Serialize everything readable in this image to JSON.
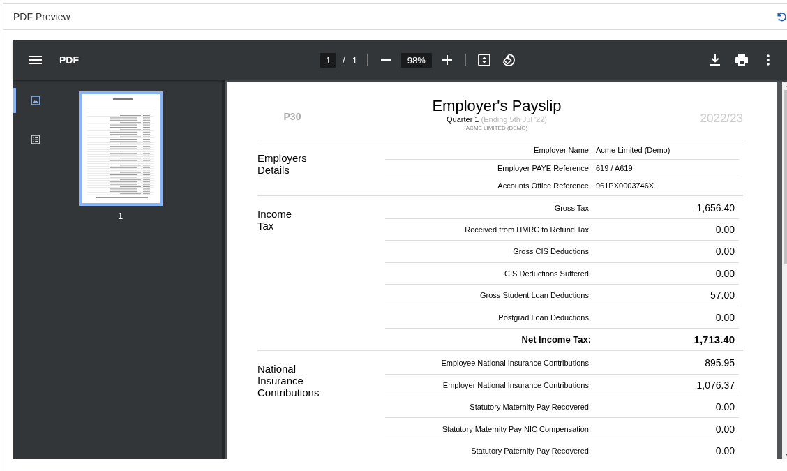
{
  "panel": {
    "title": "PDF Preview"
  },
  "toolbar": {
    "title": "PDF",
    "page": "1",
    "page_separator": "/",
    "page_count": "1",
    "zoom": "98%"
  },
  "sidebar": {
    "tabs": [
      {
        "kind": "thumbnails",
        "selected": true
      },
      {
        "kind": "outline",
        "selected": false
      }
    ],
    "thumbnails": [
      {
        "label": "1",
        "selected": true
      }
    ]
  },
  "document": {
    "form": "P30",
    "title": "Employer's Payslip",
    "quarter": "Quarter 1",
    "quarter_note": "(Ending 5th Jul '22)",
    "company": "ACME LIMITED (DEMO)",
    "year": "2022/23",
    "sections": [
      {
        "title": [
          "Employers",
          "Details"
        ],
        "rows": [
          {
            "kind": "detail",
            "label": "Employer Name:",
            "value": "Acme Limited (Demo)"
          },
          {
            "kind": "detail",
            "label": "Employer PAYE Reference:",
            "value": "619 / A619"
          },
          {
            "kind": "detail",
            "label": "Accounts Office Reference:",
            "value": "961PX0003746X"
          }
        ]
      },
      {
        "title": [
          "Income",
          "Tax"
        ],
        "rows": [
          {
            "kind": "amount",
            "label": "Gross Tax:",
            "value": "1,656.40"
          },
          {
            "kind": "amount",
            "label": "Received from HMRC to Refund Tax:",
            "value": "0.00"
          },
          {
            "kind": "amount",
            "label": "Gross CIS Deductions:",
            "value": "0.00"
          },
          {
            "kind": "amount",
            "label": "CIS Deductions Suffered:",
            "value": "0.00"
          },
          {
            "kind": "amount",
            "label": "Gross Student Loan Deductions:",
            "value": "57.00"
          },
          {
            "kind": "amount",
            "label": "Postgrad Loan Deductions:",
            "value": "0.00"
          },
          {
            "kind": "total",
            "label": "Net Income Tax:",
            "value": "1,713.40"
          }
        ]
      },
      {
        "title": [
          "National",
          "Insurance",
          "Contributions"
        ],
        "rows": [
          {
            "kind": "amount",
            "label": "Employee National Insurance Contributions:",
            "value": "895.95"
          },
          {
            "kind": "amount",
            "label": "Employer National Insurance Contributions:",
            "value": "1,076.37"
          },
          {
            "kind": "amount",
            "label": "Statutory Maternity Pay Recovered:",
            "value": "0.00"
          },
          {
            "kind": "amount",
            "label": "Statutory Maternity Pay NIC Compensation:",
            "value": "0.00"
          },
          {
            "kind": "amount",
            "label": "Statutory Paternity Pay Recovered:",
            "value": "0.00"
          }
        ]
      }
    ]
  }
}
